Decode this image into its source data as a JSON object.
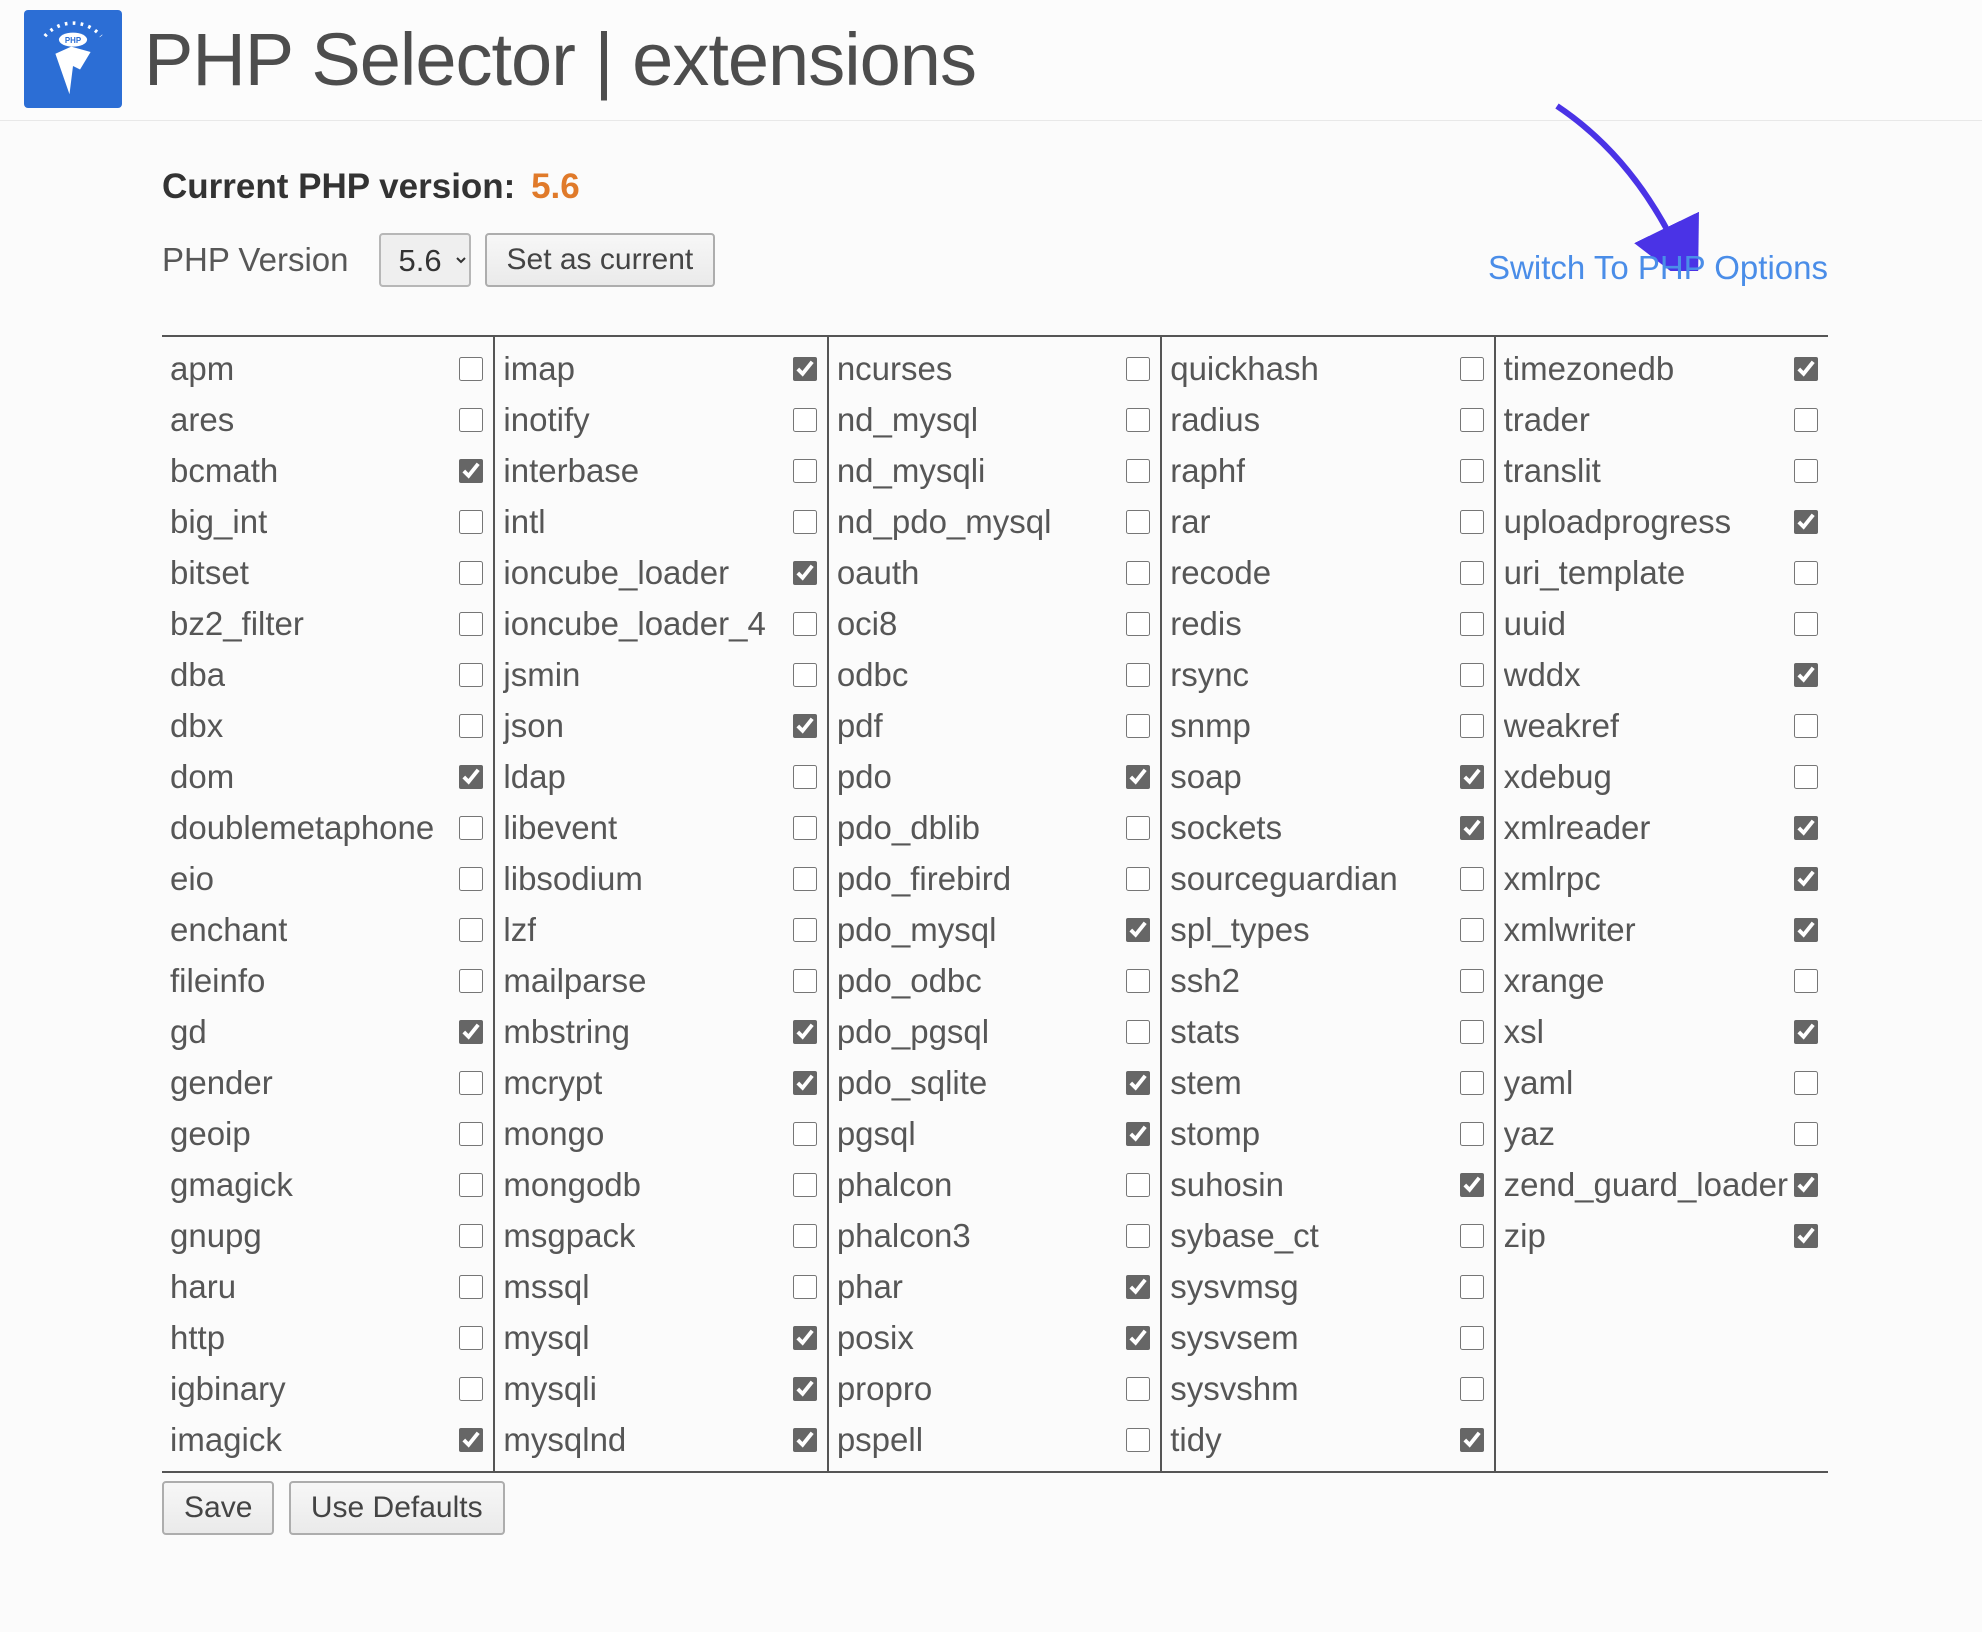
{
  "header": {
    "title": "PHP Selector | extensions"
  },
  "current": {
    "label": "Current PHP version:",
    "value": "5.6"
  },
  "version": {
    "label": "PHP Version",
    "selected": "5.6",
    "button": "Set as current"
  },
  "switch_link": "Switch To PHP Options",
  "actions": {
    "save": "Save",
    "defaults": "Use Defaults"
  },
  "columns": [
    [
      {
        "name": "apm",
        "checked": false
      },
      {
        "name": "ares",
        "checked": false
      },
      {
        "name": "bcmath",
        "checked": true
      },
      {
        "name": "big_int",
        "checked": false
      },
      {
        "name": "bitset",
        "checked": false
      },
      {
        "name": "bz2_filter",
        "checked": false
      },
      {
        "name": "dba",
        "checked": false
      },
      {
        "name": "dbx",
        "checked": false
      },
      {
        "name": "dom",
        "checked": true
      },
      {
        "name": "doublemetaphone",
        "checked": false
      },
      {
        "name": "eio",
        "checked": false
      },
      {
        "name": "enchant",
        "checked": false
      },
      {
        "name": "fileinfo",
        "checked": false
      },
      {
        "name": "gd",
        "checked": true
      },
      {
        "name": "gender",
        "checked": false
      },
      {
        "name": "geoip",
        "checked": false
      },
      {
        "name": "gmagick",
        "checked": false
      },
      {
        "name": "gnupg",
        "checked": false
      },
      {
        "name": "haru",
        "checked": false
      },
      {
        "name": "http",
        "checked": false
      },
      {
        "name": "igbinary",
        "checked": false
      },
      {
        "name": "imagick",
        "checked": true
      }
    ],
    [
      {
        "name": "imap",
        "checked": true
      },
      {
        "name": "inotify",
        "checked": false
      },
      {
        "name": "interbase",
        "checked": false
      },
      {
        "name": "intl",
        "checked": false
      },
      {
        "name": "ioncube_loader",
        "checked": true
      },
      {
        "name": "ioncube_loader_4",
        "checked": false
      },
      {
        "name": "jsmin",
        "checked": false
      },
      {
        "name": "json",
        "checked": true
      },
      {
        "name": "ldap",
        "checked": false
      },
      {
        "name": "libevent",
        "checked": false
      },
      {
        "name": "libsodium",
        "checked": false
      },
      {
        "name": "lzf",
        "checked": false
      },
      {
        "name": "mailparse",
        "checked": false
      },
      {
        "name": "mbstring",
        "checked": true
      },
      {
        "name": "mcrypt",
        "checked": true
      },
      {
        "name": "mongo",
        "checked": false
      },
      {
        "name": "mongodb",
        "checked": false
      },
      {
        "name": "msgpack",
        "checked": false
      },
      {
        "name": "mssql",
        "checked": false
      },
      {
        "name": "mysql",
        "checked": true
      },
      {
        "name": "mysqli",
        "checked": true
      },
      {
        "name": "mysqlnd",
        "checked": true
      }
    ],
    [
      {
        "name": "ncurses",
        "checked": false
      },
      {
        "name": "nd_mysql",
        "checked": false
      },
      {
        "name": "nd_mysqli",
        "checked": false
      },
      {
        "name": "nd_pdo_mysql",
        "checked": false
      },
      {
        "name": "oauth",
        "checked": false
      },
      {
        "name": "oci8",
        "checked": false
      },
      {
        "name": "odbc",
        "checked": false
      },
      {
        "name": "pdf",
        "checked": false
      },
      {
        "name": "pdo",
        "checked": true
      },
      {
        "name": "pdo_dblib",
        "checked": false
      },
      {
        "name": "pdo_firebird",
        "checked": false
      },
      {
        "name": "pdo_mysql",
        "checked": true
      },
      {
        "name": "pdo_odbc",
        "checked": false
      },
      {
        "name": "pdo_pgsql",
        "checked": false
      },
      {
        "name": "pdo_sqlite",
        "checked": true
      },
      {
        "name": "pgsql",
        "checked": true
      },
      {
        "name": "phalcon",
        "checked": false
      },
      {
        "name": "phalcon3",
        "checked": false
      },
      {
        "name": "phar",
        "checked": true
      },
      {
        "name": "posix",
        "checked": true
      },
      {
        "name": "propro",
        "checked": false
      },
      {
        "name": "pspell",
        "checked": false
      }
    ],
    [
      {
        "name": "quickhash",
        "checked": false
      },
      {
        "name": "radius",
        "checked": false
      },
      {
        "name": "raphf",
        "checked": false
      },
      {
        "name": "rar",
        "checked": false
      },
      {
        "name": "recode",
        "checked": false
      },
      {
        "name": "redis",
        "checked": false
      },
      {
        "name": "rsync",
        "checked": false
      },
      {
        "name": "snmp",
        "checked": false
      },
      {
        "name": "soap",
        "checked": true
      },
      {
        "name": "sockets",
        "checked": true
      },
      {
        "name": "sourceguardian",
        "checked": false
      },
      {
        "name": "spl_types",
        "checked": false
      },
      {
        "name": "ssh2",
        "checked": false
      },
      {
        "name": "stats",
        "checked": false
      },
      {
        "name": "stem",
        "checked": false
      },
      {
        "name": "stomp",
        "checked": false
      },
      {
        "name": "suhosin",
        "checked": true
      },
      {
        "name": "sybase_ct",
        "checked": false
      },
      {
        "name": "sysvmsg",
        "checked": false
      },
      {
        "name": "sysvsem",
        "checked": false
      },
      {
        "name": "sysvshm",
        "checked": false
      },
      {
        "name": "tidy",
        "checked": true
      }
    ],
    [
      {
        "name": "timezonedb",
        "checked": true
      },
      {
        "name": "trader",
        "checked": false
      },
      {
        "name": "translit",
        "checked": false
      },
      {
        "name": "uploadprogress",
        "checked": true
      },
      {
        "name": "uri_template",
        "checked": false
      },
      {
        "name": "uuid",
        "checked": false
      },
      {
        "name": "wddx",
        "checked": true
      },
      {
        "name": "weakref",
        "checked": false
      },
      {
        "name": "xdebug",
        "checked": false
      },
      {
        "name": "xmlreader",
        "checked": true
      },
      {
        "name": "xmlrpc",
        "checked": true
      },
      {
        "name": "xmlwriter",
        "checked": true
      },
      {
        "name": "xrange",
        "checked": false
      },
      {
        "name": "xsl",
        "checked": true
      },
      {
        "name": "yaml",
        "checked": false
      },
      {
        "name": "yaz",
        "checked": false
      },
      {
        "name": "zend_guard_loader",
        "checked": true
      },
      {
        "name": "zip",
        "checked": true
      }
    ]
  ]
}
